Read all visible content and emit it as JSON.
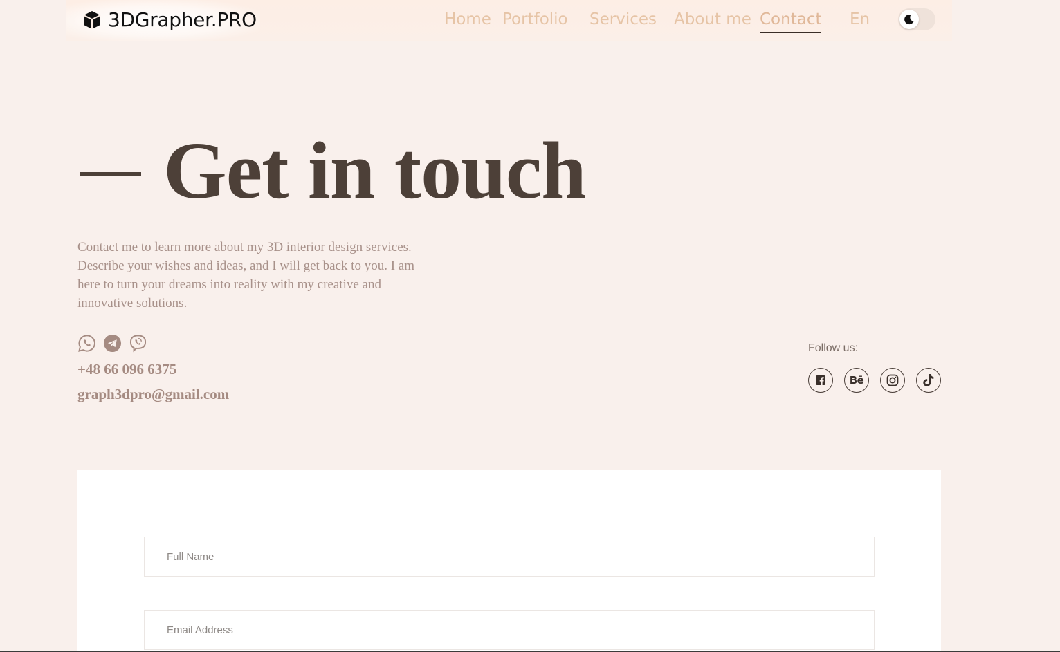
{
  "header": {
    "brand": "3DGrapher.PRO",
    "nav": [
      {
        "label": "Home"
      },
      {
        "label": "Portfolio"
      },
      {
        "label": "Services"
      },
      {
        "label": "About me"
      },
      {
        "label": "Contact"
      }
    ],
    "language": "En",
    "active_nav": "Contact"
  },
  "hero": {
    "title": "Get in touch",
    "intro": "Contact me to learn more about my 3D interior design services. Describe your wishes and ideas, and I will get back to you. I am here to turn your dreams into reality with my creative and innovative solutions."
  },
  "contacts": {
    "messengers": [
      "whatsapp-icon",
      "telegram-icon",
      "viber-icon"
    ],
    "phone": "+48 66 096 6375",
    "email": "graph3dpro@gmail.com"
  },
  "follow": {
    "label": "Follow us:",
    "socials": [
      {
        "icon": "facebook-icon"
      },
      {
        "icon": "behance-icon",
        "text": "Bē"
      },
      {
        "icon": "instagram-icon"
      },
      {
        "icon": "tiktok-icon"
      }
    ]
  },
  "form": {
    "full_name_placeholder": "Full Name",
    "email_placeholder": "Email Address"
  },
  "colors": {
    "background": "#f9f0ec",
    "nav_link": "#e6c4a6",
    "heading": "#4d4038",
    "body_text": "#a8918a"
  }
}
